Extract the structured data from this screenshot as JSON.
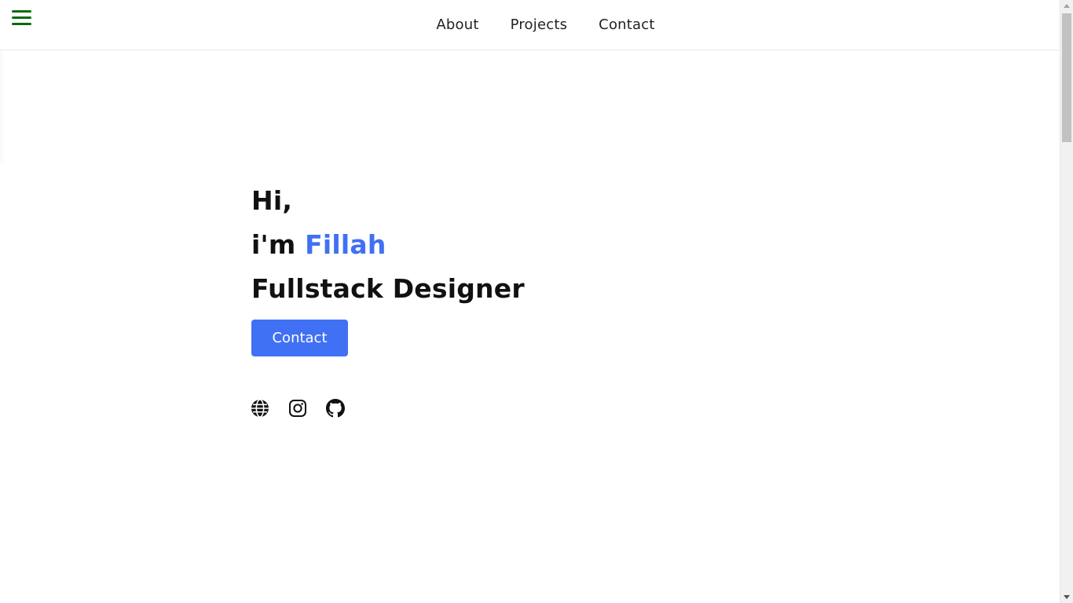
{
  "navbar": {
    "menu_icon": "hamburger-menu-icon",
    "links": [
      "About",
      "Projects",
      "Contact"
    ]
  },
  "hero": {
    "greeting": "Hi,",
    "intro_prefix": "i'm ",
    "name": "Fillah",
    "role": "Fullstack Designer",
    "contact_button": "Contact"
  },
  "socials": [
    {
      "icon": "globe-icon"
    },
    {
      "icon": "instagram-icon"
    },
    {
      "icon": "github-icon"
    }
  ],
  "colors": {
    "accent": "#4070f4",
    "menu_icon": "#0d6b0d",
    "text": "#111111",
    "background": "#ffffff"
  }
}
